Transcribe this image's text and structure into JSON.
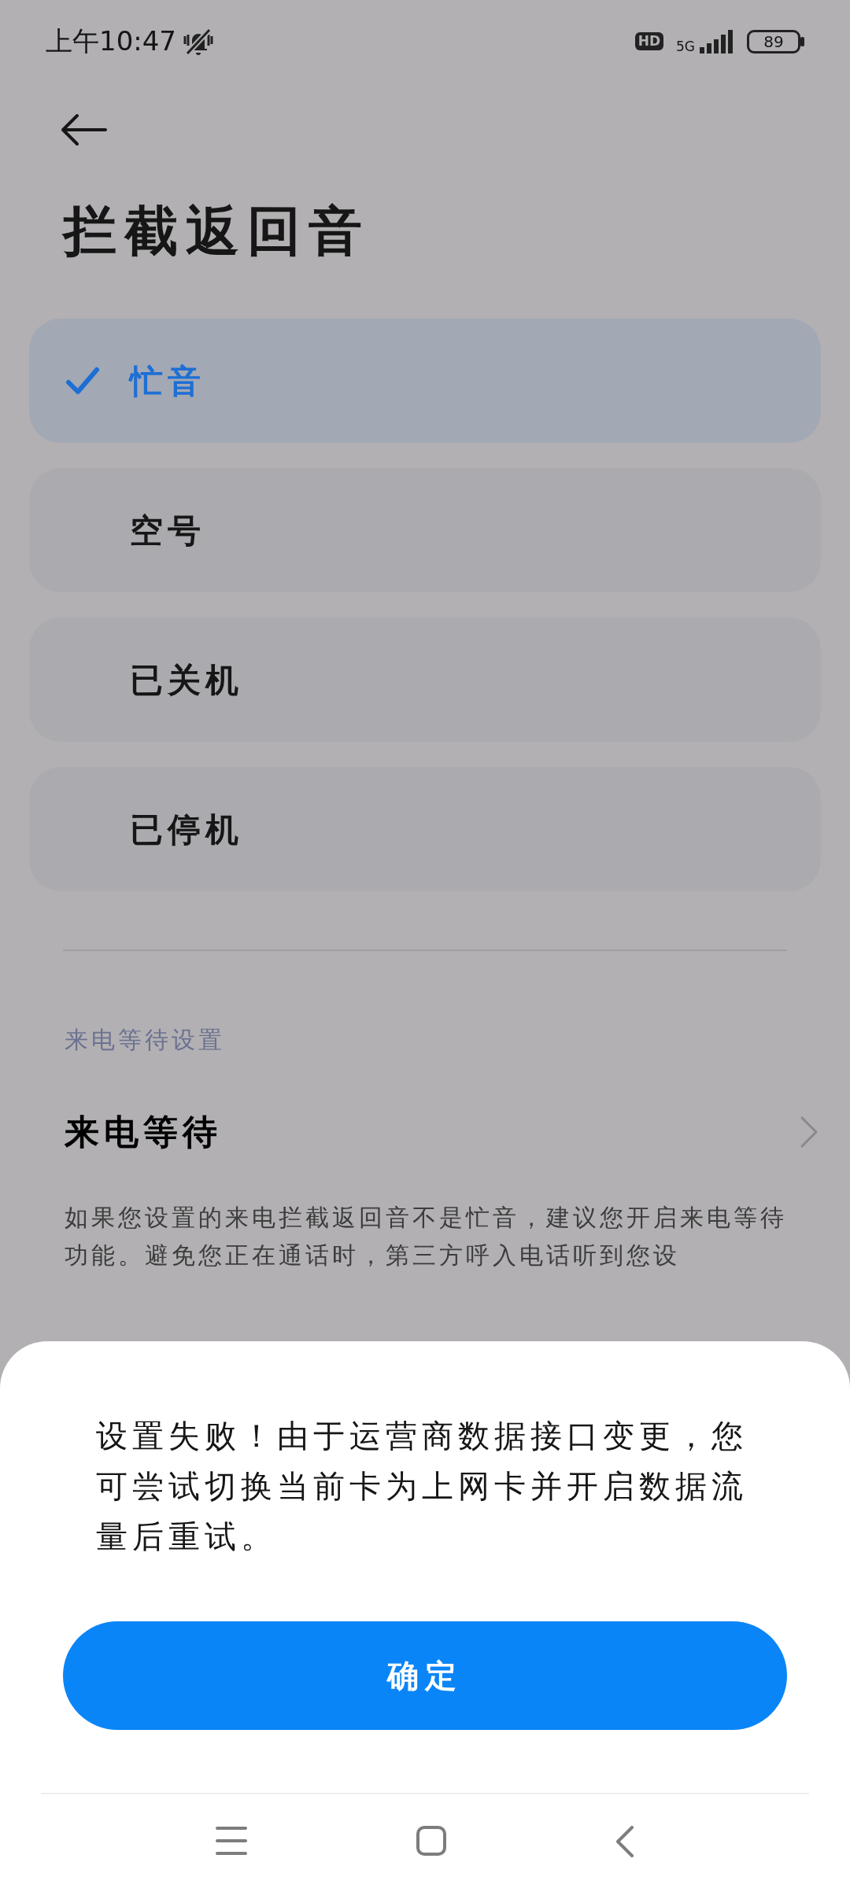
{
  "status_bar": {
    "time": "上午10:47",
    "hd_badge": "HD",
    "network": "5G",
    "battery": "89"
  },
  "title": "拦截返回音",
  "options": [
    {
      "label": "忙音",
      "selected": true
    },
    {
      "label": "空号",
      "selected": false
    },
    {
      "label": "已关机",
      "selected": false
    },
    {
      "label": "已停机",
      "selected": false
    }
  ],
  "section_label": "来电等待设置",
  "call_waiting_row": {
    "label": "来电等待"
  },
  "description": "如果您设置的来电拦截返回音不是忙音，建议您开启来电等待功能。避免您正在通话时，第三方呼入电话听到您设",
  "dialog": {
    "message": "设置失败！由于运营商数据接口变更，您可尝试切换当前卡为上网卡并开启数据流量后重试。",
    "button": "确定"
  }
}
